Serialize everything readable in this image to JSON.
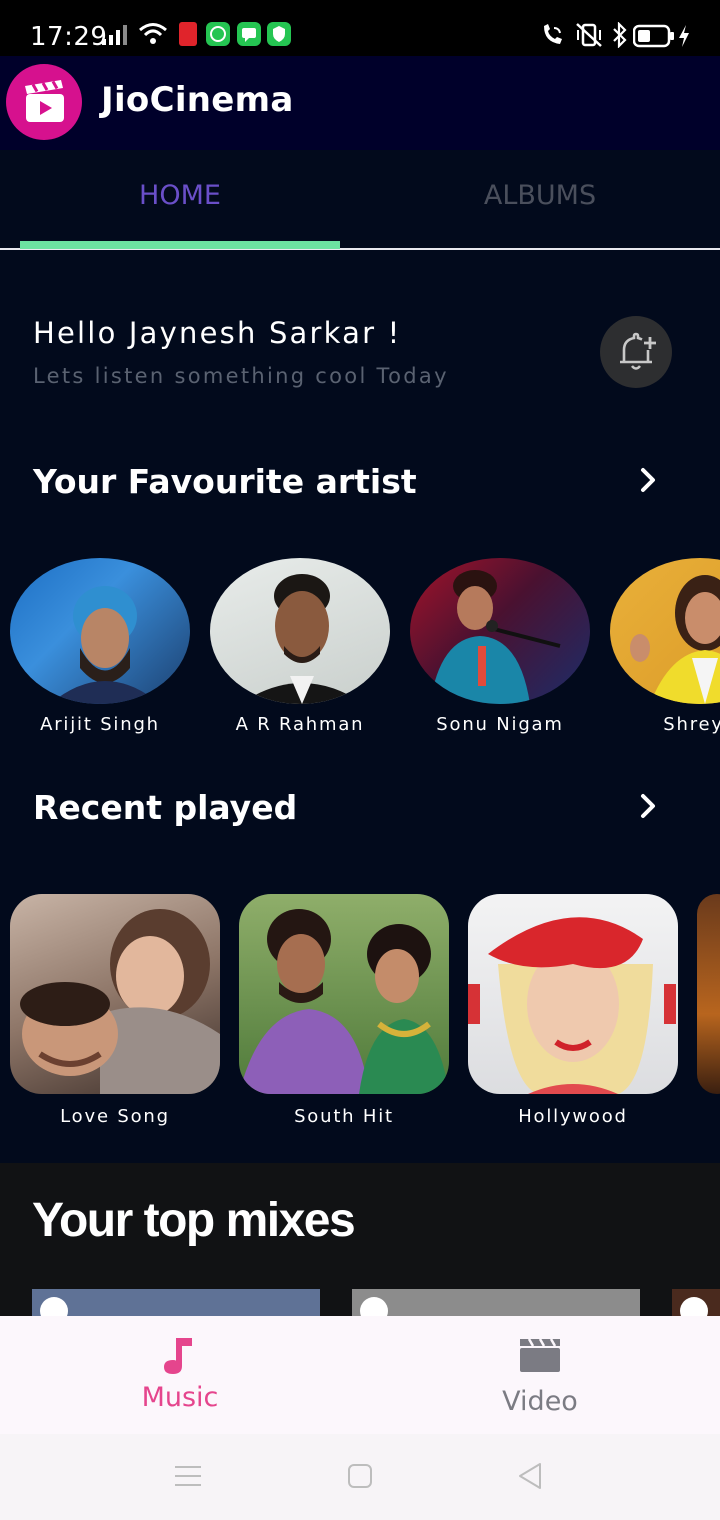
{
  "status_bar": {
    "time": "17:29",
    "left_icons": [
      "signal-icon",
      "wifi-icon",
      "red-app-icon",
      "whatsapp-icon",
      "message-icon",
      "shield-icon"
    ],
    "right_icons": [
      "wifi-calling-icon",
      "vibrate-icon",
      "bluetooth-icon",
      "battery-icon",
      "charging-icon"
    ]
  },
  "header": {
    "app_name": "JioCinema",
    "logo_color": "#d6118e"
  },
  "tabs": {
    "items": [
      {
        "label": "HOME",
        "selected": true
      },
      {
        "label": "ALBUMS",
        "selected": false
      }
    ],
    "indicator_color": "#6ce3a1"
  },
  "greeting": {
    "title": "Hello Jaynesh Sarkar !",
    "subtitle": "Lets listen something cool Today"
  },
  "artists_section": {
    "title": "Your Favourite artist",
    "items": [
      {
        "name": "Arijit Singh"
      },
      {
        "name": "A R Rahman"
      },
      {
        "name": "Sonu Nigam"
      },
      {
        "name": "Shreya"
      }
    ]
  },
  "recent_section": {
    "title": "Recent played",
    "items": [
      {
        "name": "Love Song"
      },
      {
        "name": "South Hit"
      },
      {
        "name": "Hollywood"
      }
    ]
  },
  "mixes_section": {
    "title": "Your top mixes"
  },
  "bottom_nav": {
    "items": [
      {
        "label": "Music",
        "icon": "music-note-icon",
        "active": true
      },
      {
        "label": "Video",
        "icon": "clapperboard-icon",
        "active": false
      }
    ],
    "active_color": "#e5458d",
    "inactive_color": "#7b7b83"
  },
  "colors": {
    "background": "#020a1c",
    "accent_purple": "#6a4fc9"
  }
}
